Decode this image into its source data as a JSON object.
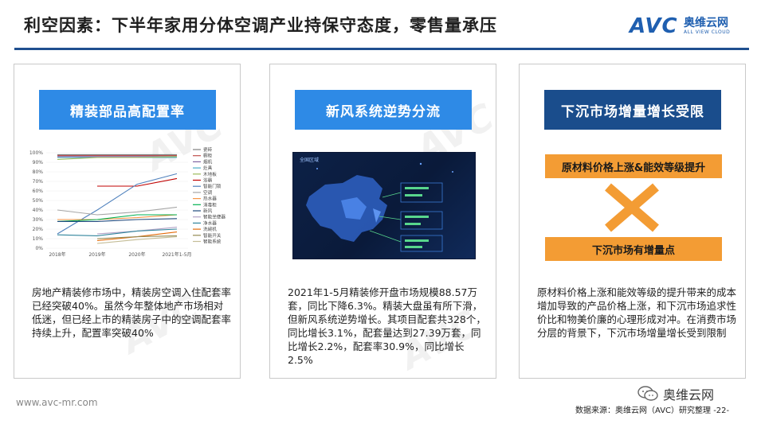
{
  "header": {
    "title": "利空因素：下半年家用分体空调产业持保守态度，零售量承压",
    "logo_avc": "AVC",
    "logo_cn": "奥维云网",
    "logo_en": "ALL VIEW CLOUD"
  },
  "panels": [
    {
      "banner": "精装部品高配置率",
      "text": "房地产精装修市场中，精装房空调入住配套率已经突破40%。虽然今年整体地产市场相对低迷，但已经上市的精装房子中的空调配套率持续上升，配置率突破40%"
    },
    {
      "banner": "新风系统逆势分流",
      "map_title": "全国区域",
      "text": "2021年1-5月精装修开盘市场规模88.57万套，同比下降6.3%。精装大盘虽有所下滑，但新风系统逆势增长。其项目配套共328个，同比增长3.1%，配套量达到27.39万套，同比增长2.2%，配套率30.9%，同比增长2.5%"
    },
    {
      "banner": "下沉市场增量增长受限",
      "bar_top": "原材料价格上涨&能效等级提升",
      "bar_bottom": "下沉市场有增量点",
      "text": "原材料价格上涨和能效等级的提升带来的成本增加导致的产品价格上涨，和下沉市场追求性价比和物美价廉的心理形成对冲。在消费市场分层的背景下，下沉市场增量增长受到限制"
    }
  ],
  "chart_data": {
    "type": "line",
    "categories": [
      "2018年",
      "2019年",
      "2020年",
      "2021年1-5月"
    ],
    "y_ticks": [
      "0%",
      "10%",
      "20%",
      "30%",
      "40%",
      "50%",
      "60%",
      "70%",
      "80%",
      "90%",
      "100%"
    ],
    "ylim": [
      0,
      100
    ],
    "series": [
      {
        "name": "瓷砖",
        "color": "#7f7f7f",
        "values": [
          98,
          98,
          98,
          98
        ]
      },
      {
        "name": "橱柜",
        "color": "#c0504d",
        "values": [
          97,
          97,
          97,
          97
        ]
      },
      {
        "name": "烟机",
        "color": "#8064a2",
        "values": [
          96,
          96,
          96,
          96
        ]
      },
      {
        "name": "灶具",
        "color": "#4bacc6",
        "values": [
          95,
          95,
          95,
          95
        ]
      },
      {
        "name": "木地板",
        "color": "#9bbb59",
        "values": [
          93,
          95,
          95,
          96
        ]
      },
      {
        "name": "浴霸",
        "color": "#c00000",
        "values": [
          null,
          65,
          65,
          73
        ]
      },
      {
        "name": "智能门锁",
        "color": "#4f81bd",
        "values": [
          15,
          40,
          67,
          78
        ]
      },
      {
        "name": "空调",
        "color": "#a6a6a6",
        "values": [
          40,
          35,
          38,
          43
        ]
      },
      {
        "name": "热水器",
        "color": "#f79646",
        "values": [
          30,
          30,
          32,
          35
        ]
      },
      {
        "name": "消毒柜",
        "color": "#00b050",
        "values": [
          28,
          30,
          35,
          35
        ]
      },
      {
        "name": "新风",
        "color": "#1f497d",
        "values": [
          28,
          28,
          30,
          31
        ]
      },
      {
        "name": "智能坐便器",
        "color": "#b3a2c7",
        "values": [
          null,
          15,
          18,
          22
        ]
      },
      {
        "name": "净水器",
        "color": "#31859c",
        "values": [
          14,
          13,
          18,
          20
        ]
      },
      {
        "name": "洗碗机",
        "color": "#e46c0a",
        "values": [
          null,
          8,
          12,
          17
        ]
      },
      {
        "name": "智能开关",
        "color": "#948a54",
        "values": [
          null,
          10,
          12,
          13
        ]
      },
      {
        "name": "智能系统",
        "color": "#c4bd97",
        "values": [
          null,
          5,
          9,
          12
        ]
      }
    ]
  },
  "footer": {
    "website": "www.avc-mr.com",
    "wechat": "奥维云网",
    "source": "数据来源：奥维云网（AVC）研究整理 -22-"
  }
}
